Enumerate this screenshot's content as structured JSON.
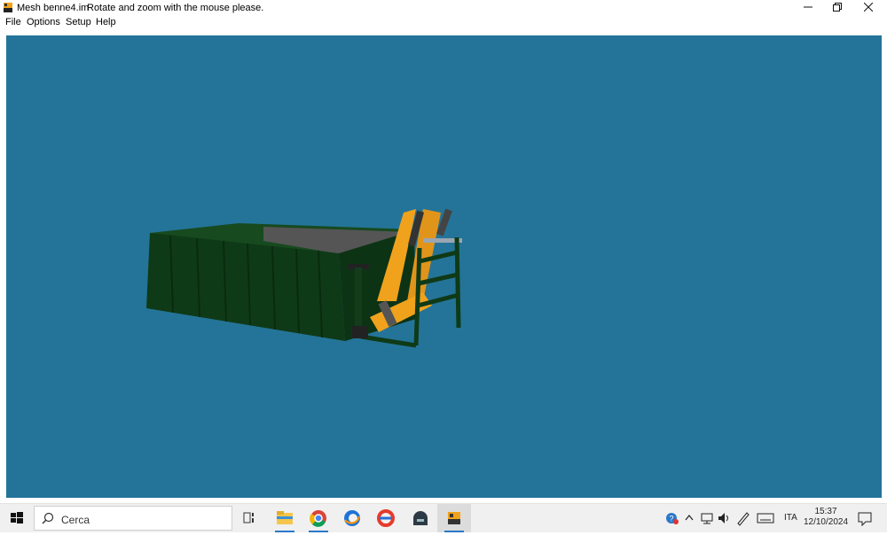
{
  "window": {
    "title": "Mesh benne4.im",
    "hint": "Rotate and zoom with the mouse please.",
    "controls": [
      "minimize",
      "restore",
      "close"
    ]
  },
  "menu": {
    "items": [
      {
        "label": "File"
      },
      {
        "label": "Options"
      },
      {
        "label": "Setup"
      },
      {
        "label": "Help"
      }
    ]
  },
  "viewport": {
    "background": "#247499",
    "scene": "container-with-crane",
    "container_color": "#0f3a17",
    "crane_color": "#f0a21c"
  },
  "taskbar": {
    "search_placeholder": "Cerca",
    "apps": [
      "task-view-icon",
      "file-explorer-icon",
      "chrome-icon",
      "browser-icon",
      "app-icon",
      "game-icon",
      "mesh-viewer-icon"
    ],
    "tray": {
      "language": "ITA",
      "time": "15:37",
      "date": "12/10/2024"
    }
  }
}
